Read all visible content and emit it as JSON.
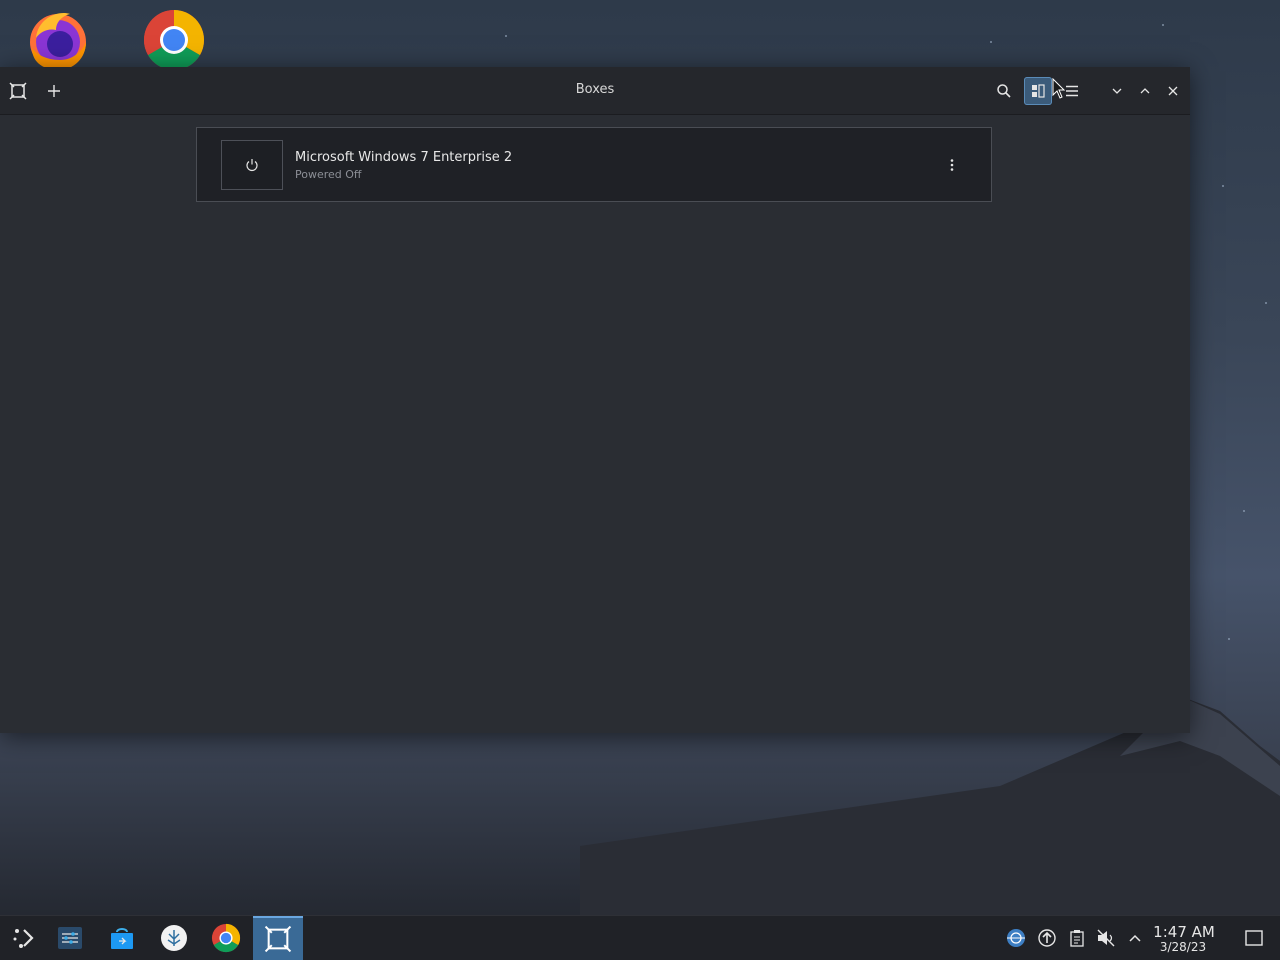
{
  "window": {
    "title": "Boxes"
  },
  "boxes": [
    {
      "name": "Microsoft Windows 7 Enterprise 2",
      "status": "Powered Off"
    }
  ],
  "desktop": {
    "icons": [
      "firefox-icon",
      "chrome-icon"
    ]
  },
  "taskbar": {
    "time": "1:47 AM",
    "date": "3/28/23"
  },
  "colors": {
    "accent": "#3b5b7a",
    "window_bg": "#2a2d33",
    "headerbar_bg": "#25272c",
    "taskbar_bg": "#202227"
  }
}
